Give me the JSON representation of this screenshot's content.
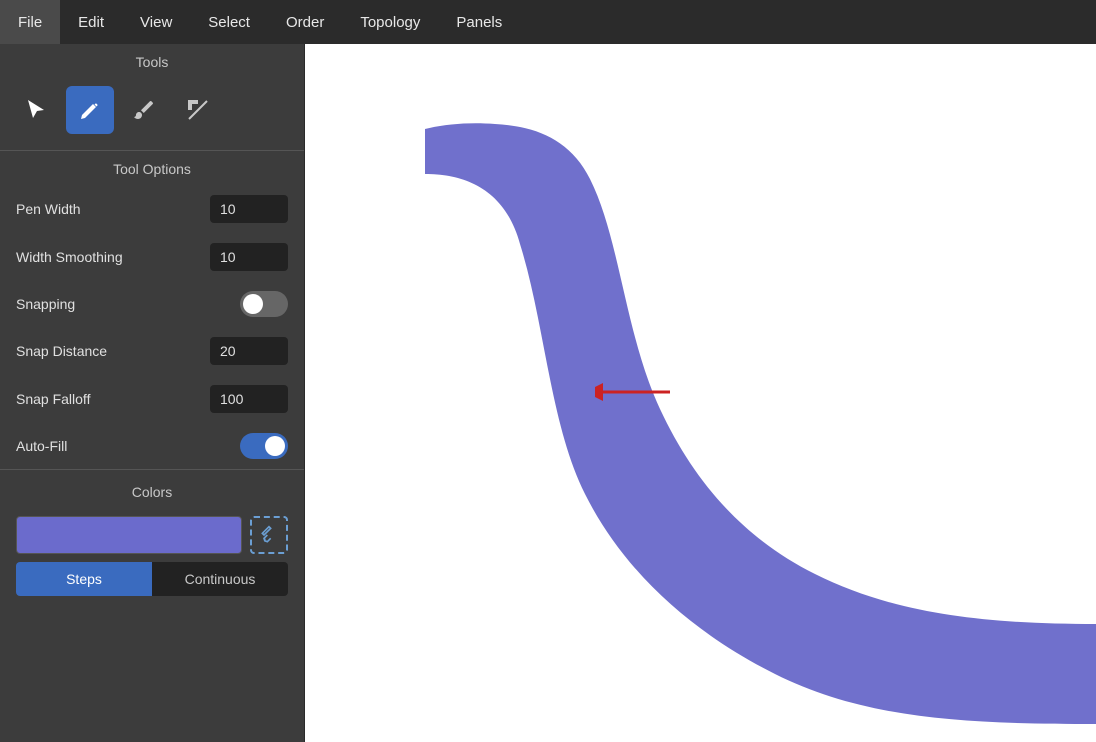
{
  "menubar": {
    "items": [
      "File",
      "Edit",
      "View",
      "Select",
      "Order",
      "Topology",
      "Panels"
    ]
  },
  "sidebar": {
    "tools_title": "Tools",
    "tools": [
      {
        "name": "select-tool",
        "label": "Select",
        "active": false
      },
      {
        "name": "pen-tool",
        "label": "Pen",
        "active": true
      },
      {
        "name": "paint-tool",
        "label": "Paint",
        "active": false
      },
      {
        "name": "corner-tool",
        "label": "Corner",
        "active": false
      }
    ],
    "tool_options_title": "Tool Options",
    "pen_width_label": "Pen Width",
    "pen_width_value": "10",
    "width_smoothing_label": "Width Smoothing",
    "width_smoothing_value": "10",
    "snapping_label": "Snapping",
    "snapping_on": false,
    "snap_distance_label": "Snap Distance",
    "snap_distance_value": "20",
    "snap_falloff_label": "Snap Falloff",
    "snap_falloff_value": "100",
    "auto_fill_label": "Auto-Fill",
    "auto_fill_on": true,
    "colors_title": "Colors",
    "color_hex": "#6b6bcc",
    "steps_label": "Steps",
    "continuous_label": "Continuous"
  },
  "arrow": {
    "color": "#cc2222"
  }
}
